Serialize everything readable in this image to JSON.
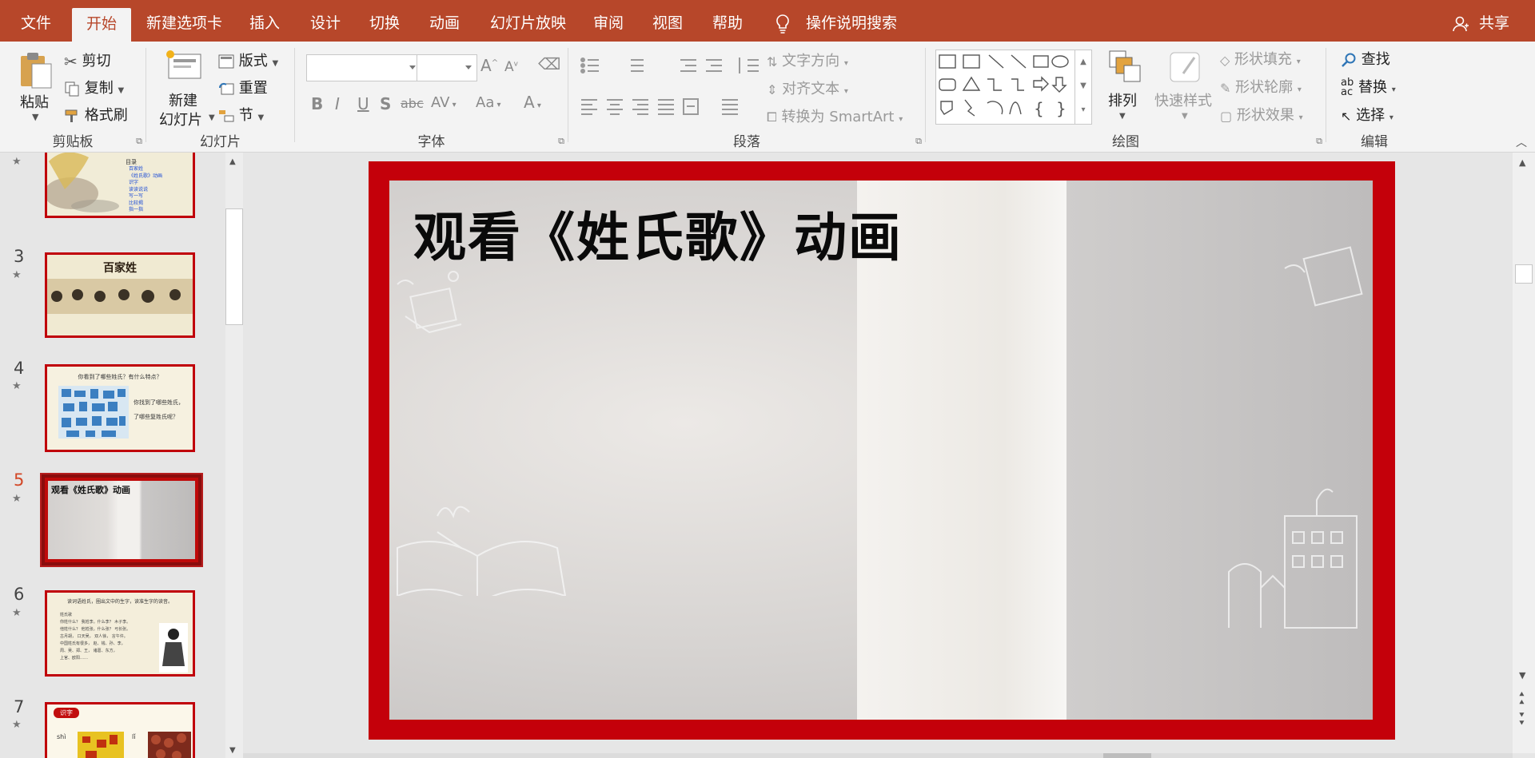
{
  "tabs": {
    "file": "文件",
    "home": "开始",
    "new_tab": "新建选项卡",
    "insert": "插入",
    "design": "设计",
    "transitions": "切换",
    "animations": "动画",
    "slideshow": "幻灯片放映",
    "review": "审阅",
    "view": "视图",
    "help": "帮助",
    "tell_me": "操作说明搜索",
    "share": "共享"
  },
  "ribbon": {
    "clipboard": {
      "label": "剪贴板",
      "paste": "粘贴",
      "cut": "剪切",
      "copy": "复制",
      "format_painter": "格式刷"
    },
    "slides": {
      "label": "幻灯片",
      "new_slide_line1": "新建",
      "new_slide_line2": "幻灯片",
      "layout": "版式",
      "reset": "重置",
      "section": "节"
    },
    "font": {
      "label": "字体",
      "case_btn": "Aa"
    },
    "paragraph": {
      "label": "段落",
      "text_direction": "文字方向",
      "align_text": "对齐文本",
      "smartart": "转换为 SmartArt"
    },
    "drawing": {
      "label": "绘图",
      "arrange": "排列",
      "quick_styles": "快速样式",
      "shape_fill": "形状填充",
      "shape_outline": "形状轮廓",
      "shape_effects": "形状效果"
    },
    "editing": {
      "label": "编辑",
      "find": "查找",
      "replace": "替换",
      "select": "选择"
    }
  },
  "thumbnails": [
    {
      "number": "",
      "title": "目录",
      "items": [
        "百家姓",
        "《姓氏歌》动画",
        "识字",
        "读读说说",
        "写一写",
        "比较揭",
        "指一指"
      ]
    },
    {
      "number": "3",
      "title": "百家姓"
    },
    {
      "number": "4",
      "title": "你看到了哪些姓氏？有什么特点？",
      "side_text_1": "你找到了哪些姓氏，",
      "side_text_2": "了哪些复姓氏呢？"
    },
    {
      "number": "5",
      "title": "观看《姓氏歌》动画"
    },
    {
      "number": "6",
      "title": "读词语姓氏，圈出文中的生字，读准生字的读音。",
      "lines": [
        "姓氏歌",
        "你姓什么？ 我姓李。什么李？ 木子李。",
        "他姓什么？ 他姓张。什么张？ 弓长张。",
        "古月胡， 口天吴， 双人徐， 言午许。",
        "中国姓氏有很多， 赵、钱、孙、李，",
        "周、吴、郑、王， 诸葛、东方，",
        "上官、欧阳……"
      ]
    },
    {
      "number": "7",
      "badge": "识字",
      "pinyin_1": "shì",
      "pinyin_2": "lǐ"
    }
  ],
  "slide": {
    "title": "观看《姓氏歌》动画"
  }
}
